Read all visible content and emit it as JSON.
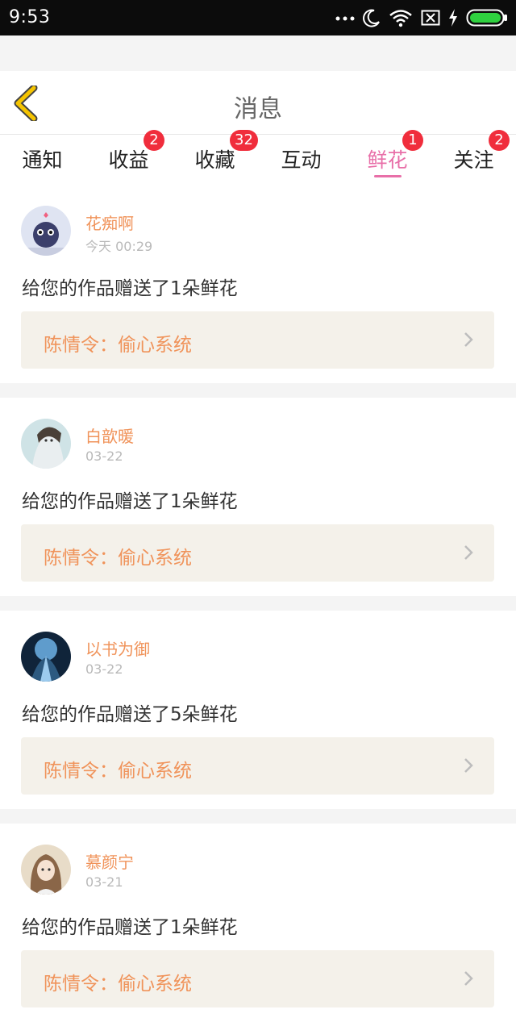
{
  "status_bar": {
    "time": "9:53",
    "icons": [
      "more-dots-icon",
      "moon-icon",
      "wifi-icon",
      "sim-icon",
      "charging-icon",
      "battery-icon"
    ]
  },
  "header": {
    "title": "消息"
  },
  "tabs": [
    {
      "label": "通知",
      "badge": ""
    },
    {
      "label": "收益",
      "badge": "2"
    },
    {
      "label": "收藏",
      "badge": "32"
    },
    {
      "label": "互动",
      "badge": ""
    },
    {
      "label": "鲜花",
      "badge": "1",
      "active": true
    },
    {
      "label": "关注",
      "badge": "2"
    }
  ],
  "messages": [
    {
      "username": "花痴啊",
      "time": "今天 00:29",
      "text": "给您的作品赠送了1朵鲜花",
      "work_title": "陈情令：偷心系统"
    },
    {
      "username": "白歆暖",
      "time": "03-22",
      "text": "给您的作品赠送了1朵鲜花",
      "work_title": "陈情令：偷心系统"
    },
    {
      "username": "以书为御",
      "time": "03-22",
      "text": "给您的作品赠送了5朵鲜花",
      "work_title": "陈情令：偷心系统"
    },
    {
      "username": "慕颜宁",
      "time": "03-21",
      "text": "给您的作品赠送了1朵鲜花",
      "work_title": "陈情令：偷心系统"
    }
  ],
  "colors": {
    "accent": "#e86fa8",
    "name": "#f0935a",
    "badge": "#f02d3c",
    "back_arrow": "#f5c400"
  }
}
